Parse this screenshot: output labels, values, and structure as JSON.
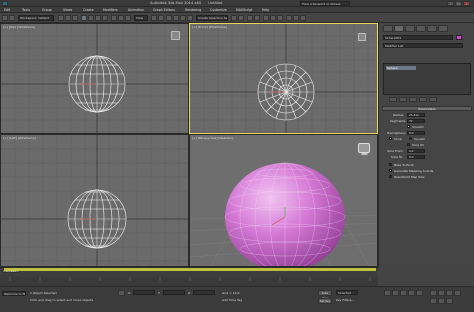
{
  "title": {
    "app": "Autodesk 3ds Max 2014 x64",
    "file": "Untitled",
    "search_placeholder": "Type a keyword or phrase"
  },
  "menu": [
    "Edit",
    "Tools",
    "Group",
    "Views",
    "Create",
    "Modifiers",
    "Animation",
    "Graph Editors",
    "Rendering",
    "Customize",
    "MAXScript",
    "Help"
  ],
  "toolbar": {
    "workspace": "Workspace: Default",
    "view_dropdown": "View",
    "selection_set": "Create Selection Se..."
  },
  "viewports": {
    "top": "[+] [Top] [Wireframe]",
    "front": "[+] [Front] [Wireframe]",
    "left": "[+] [Left] [Wireframe]",
    "perspective": "[+] [Perspective] [Realistic]"
  },
  "command_panel": {
    "object_name": "Sphere001",
    "modifier_list": "Modifier List",
    "stack_item": "Sphere",
    "rollout": "Parameters",
    "radius_label": "Radius:",
    "radius_value": "25.412",
    "segments_label": "Segments:",
    "segments_value": "32",
    "smooth_label": "Smooth",
    "hemisphere_label": "Hemisphere:",
    "hemisphere_value": "0.0",
    "chop_label": "Chop",
    "squash_label": "Squash",
    "slice_on_label": "Slice On",
    "slice_from_label": "Slice From:",
    "slice_from_value": "0.0",
    "slice_to_label": "Slice To:",
    "slice_to_value": "0.0",
    "base_pivot_label": "Base To Pivot",
    "gen_map_label": "Generate Mapping Coords.",
    "real_world_label": "Real-World Map Size"
  },
  "timeline": {
    "slider": "0 / 100"
  },
  "status": {
    "welcome": "Welcome to M",
    "selected": "1 Object Selected",
    "prompt": "Click and drag to select and move objects",
    "x_label": "X:",
    "x_value": "",
    "y_label": "Y:",
    "y_value": "",
    "z_label": "Z:",
    "z_value": "",
    "grid": "Grid = 10.0",
    "autokey": "Auto Key",
    "setkey": "Set Key",
    "key_filters": "Key Filters...",
    "selected_dropdown": "Selected",
    "add_time_tag": "Add Time Tag"
  },
  "colors": {
    "viewport_bg": "#6b6b6b",
    "active_border": "#e8d85a",
    "sphere_shaded": "#d57ad6",
    "highlight": "#d6d73d"
  }
}
